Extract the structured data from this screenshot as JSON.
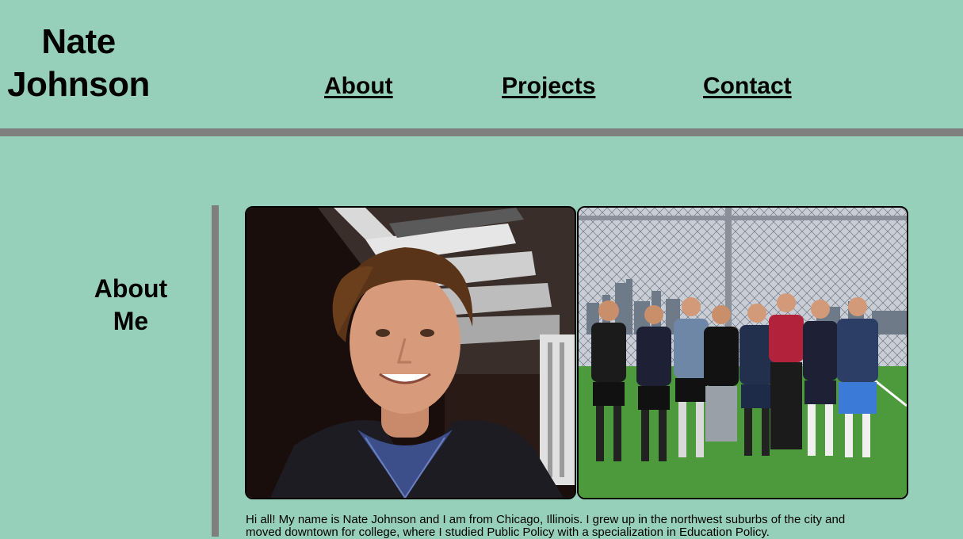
{
  "site": {
    "name_line1": "Nate",
    "name_line2": "Johnson"
  },
  "nav": {
    "about": "About",
    "projects": "Projects",
    "contact": "Contact"
  },
  "about_section": {
    "title_line1": "About",
    "title_line2": "Me",
    "bio_line1": "Hi all! My name is Nate Johnson and I am from Chicago, Illinois. I grew up in the northwest suburbs of the city and",
    "bio_line2": "moved downtown for college, where I studied Public Policy with a specialization in Education Policy."
  },
  "photos": [
    {
      "subject": "portrait-photo"
    },
    {
      "subject": "team-photo"
    }
  ],
  "colors": {
    "background": "#96d0bb",
    "divider": "#7f7f7f",
    "text": "#000000"
  }
}
